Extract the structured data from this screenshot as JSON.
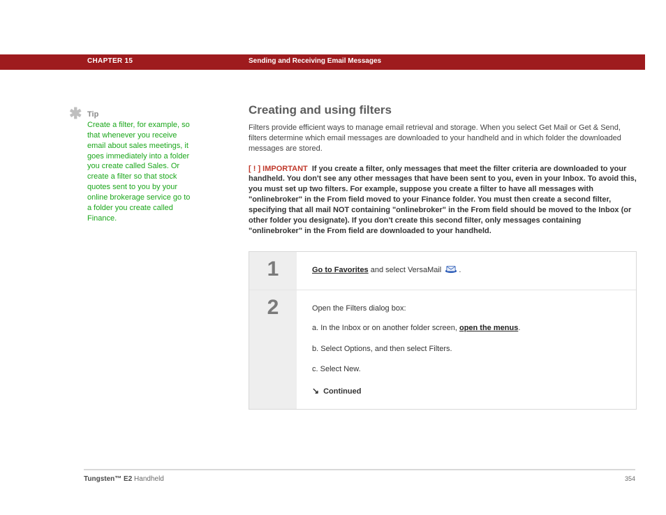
{
  "header": {
    "chapter_label": "CHAPTER 15",
    "chapter_title": "Sending and Receiving Email Messages"
  },
  "sidebar": {
    "asterisk": "✱",
    "tip_label": "Tip",
    "tip_body": "Create a filter, for example, so that whenever you receive email about sales meetings, it goes immediately into a folder you create called Sales. Or create a filter so that stock quotes sent to you by your online brokerage service go to a folder you create called Finance."
  },
  "main": {
    "heading": "Creating and using filters",
    "intro": "Filters provide efficient ways to manage email retrieval and storage. When you select Get Mail or Get & Send, filters determine which email messages are downloaded to your handheld and in which folder the downloaded messages are stored.",
    "important_marker": "[ ! ]",
    "important_label": "IMPORTANT",
    "important_body": "If you create a filter, only messages that meet the filter criteria are downloaded to your handheld. You don't see any other messages that have been sent to you, even in your Inbox. To avoid this, you must set up two filters. For example, suppose you create a filter to have all messages with \"onlinebroker\" in the From field moved to your Finance folder. You must then create a second filter, specifying that all mail NOT containing \"onlinebroker\" in the From field should be moved to the Inbox (or other folder you designate). If you don't create this second filter, only messages containing \"onlinebroker\" in the From field are downloaded to your handheld.",
    "step1": {
      "num": "1",
      "link": "Go to Favorites",
      "rest": " and select VersaMail ",
      "period": "."
    },
    "step2": {
      "num": "2",
      "lead": "Open the Filters dialog box:",
      "a_prefix": "a.  In the Inbox or on another folder screen, ",
      "a_link": "open the menus",
      "a_suffix": ".",
      "b": "b.  Select Options, and then select Filters.",
      "c": "c.  Select New.",
      "continued_arrow": "↘",
      "continued_label": "Continued"
    }
  },
  "footer": {
    "product_bold": "Tungsten™ E2",
    "product_rest": " Handheld",
    "page": "354"
  }
}
